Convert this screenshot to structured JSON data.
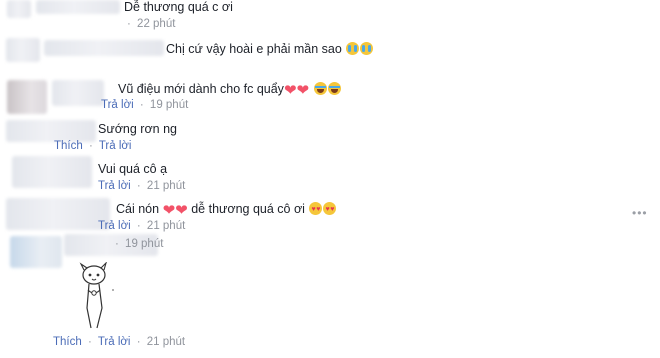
{
  "comments": [
    {
      "text": "Dễ thương quá c ơi",
      "emoji": [],
      "actions": [],
      "time": "22 phút"
    },
    {
      "text": "Chị cứ vậy hoài e phải mần sao",
      "emoji": [
        "crying-face",
        "crying-face"
      ],
      "actions": [],
      "time": ""
    },
    {
      "text": "Vũ điệu mới dành cho fc quẩy",
      "emoji": [
        "heart",
        "heart",
        "laughing-face",
        "laughing-face"
      ],
      "actions": [
        "Trả lời"
      ],
      "time": "19 phút"
    },
    {
      "text": "Sướng rơn ng",
      "emoji": [],
      "actions": [
        "Thích",
        "Trả lời"
      ],
      "time": ""
    },
    {
      "text": "Vui quá cô ạ",
      "emoji": [],
      "actions": [
        "Trả lời"
      ],
      "time": "21 phút"
    },
    {
      "text": "Cái nón",
      "text_after": "dễ thương quá cô ơi",
      "emoji": [
        "heart",
        "heart"
      ],
      "emoji_after": [
        "heart-eyes-face",
        "heart-eyes-face"
      ],
      "actions": [
        "Trả lời"
      ],
      "time": "21 phút"
    },
    {
      "text": "",
      "emoji": [],
      "actions": [],
      "time": "19 phút"
    },
    {
      "text": "",
      "sticker": "cartoon-figure-sticker",
      "emoji": [],
      "actions": [
        "Thích",
        "Trả lời"
      ],
      "time": "21 phút"
    }
  ],
  "labels": {
    "c1_time": "22 phút",
    "c3_reply": "Trả lời",
    "c3_time": "19 phút",
    "c4_like": "Thích",
    "c4_reply": "Trả lời",
    "c5_reply": "Trả lời",
    "c5_time": "21 phút",
    "c6_reply": "Trả lời",
    "c6_time": "21 phút",
    "c7_time": "19 phút",
    "c8_like": "Thích",
    "c8_reply": "Trả lời",
    "c8_time": "21 phút",
    "c6_text_after": "dễ thương quá cô ơi"
  },
  "colors": {
    "link": "#4b6cb7",
    "meta": "#90949c",
    "text": "#1d2129",
    "heart": "#f25268"
  }
}
